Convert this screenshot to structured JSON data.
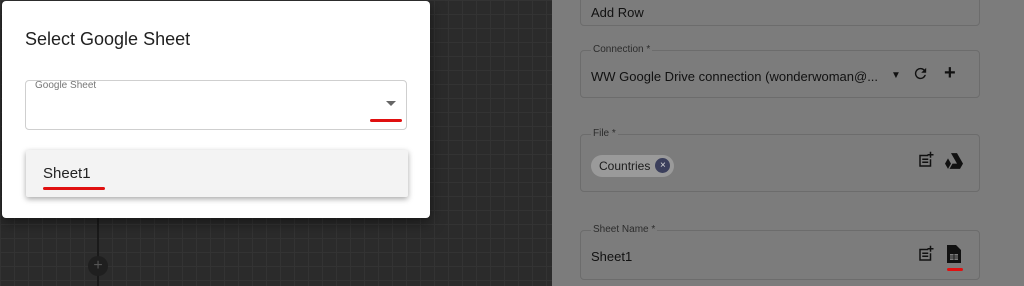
{
  "dialog": {
    "title": "Select Google Sheet",
    "field_label": "Google Sheet",
    "field_value": "",
    "options": [
      "Sheet1"
    ]
  },
  "panel": {
    "action_value": "Add Row",
    "connection": {
      "label": "Connection *",
      "value": "WW Google Drive connection (wonderwoman@..."
    },
    "file": {
      "label": "File *",
      "chip": "Countries",
      "chip_remove": "×"
    },
    "sheet_name": {
      "label": "Sheet Name *",
      "value": "Sheet1"
    }
  },
  "icons": [
    "chevron-down-icon",
    "refresh-icon",
    "plus-icon",
    "add-note-icon",
    "google-drive-icon",
    "sheet-file-icon",
    "add-node-icon"
  ],
  "colors": {
    "highlight": "#e01010",
    "chip_x_bg": "#3b3f5c"
  }
}
